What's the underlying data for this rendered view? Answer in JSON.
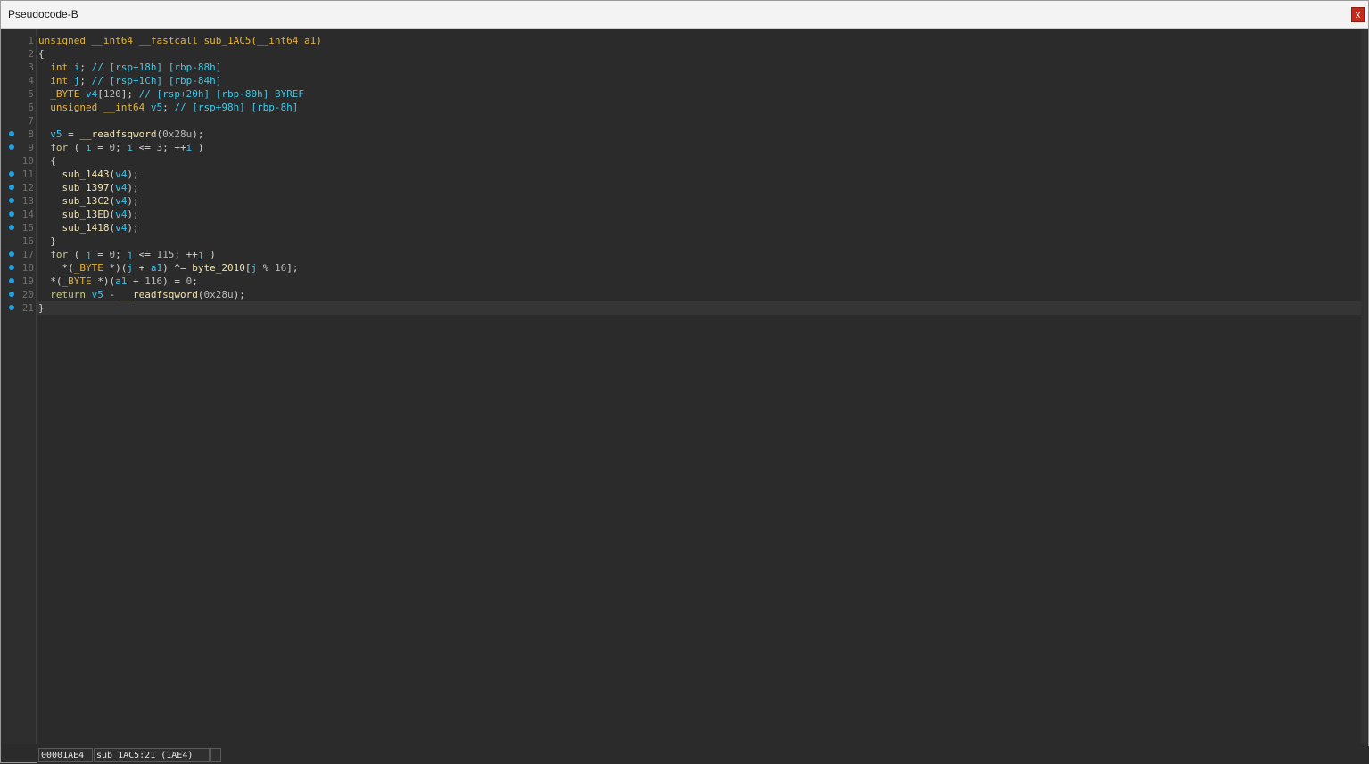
{
  "window": {
    "title": "Pseudocode-B",
    "close_label": "x"
  },
  "code": {
    "lines": [
      {
        "n": "1",
        "bp": false,
        "text": "unsigned __int64 __fastcall sub_1AC5(__int64 a1)"
      },
      {
        "n": "2",
        "bp": false,
        "text": "{"
      },
      {
        "n": "3",
        "bp": false,
        "text": "  int i; // [rsp+18h] [rbp-88h]"
      },
      {
        "n": "4",
        "bp": false,
        "text": "  int j; // [rsp+1Ch] [rbp-84h]"
      },
      {
        "n": "5",
        "bp": false,
        "text": "  _BYTE v4[120]; // [rsp+20h] [rbp-80h] BYREF"
      },
      {
        "n": "6",
        "bp": false,
        "text": "  unsigned __int64 v5; // [rsp+98h] [rbp-8h]"
      },
      {
        "n": "7",
        "bp": false,
        "text": ""
      },
      {
        "n": "8",
        "bp": true,
        "text": "  v5 = __readfsqword(0x28u);"
      },
      {
        "n": "9",
        "bp": true,
        "text": "  for ( i = 0; i <= 3; ++i )"
      },
      {
        "n": "10",
        "bp": false,
        "text": "  {"
      },
      {
        "n": "11",
        "bp": true,
        "text": "    sub_1443(v4);"
      },
      {
        "n": "12",
        "bp": true,
        "text": "    sub_1397(v4);"
      },
      {
        "n": "13",
        "bp": true,
        "text": "    sub_13C2(v4);"
      },
      {
        "n": "14",
        "bp": true,
        "text": "    sub_13ED(v4);"
      },
      {
        "n": "15",
        "bp": true,
        "text": "    sub_1418(v4);"
      },
      {
        "n": "16",
        "bp": false,
        "text": "  }"
      },
      {
        "n": "17",
        "bp": true,
        "text": "  for ( j = 0; j <= 115; ++j )"
      },
      {
        "n": "18",
        "bp": true,
        "text": "    *(_BYTE *)(j + a1) ^= byte_2010[j % 16];"
      },
      {
        "n": "19",
        "bp": true,
        "text": "  *(_BYTE *)(a1 + 116) = 0;"
      },
      {
        "n": "20",
        "bp": true,
        "text": "  return v5 - __readfsqword(0x28u);"
      },
      {
        "n": "21",
        "bp": true,
        "text": "}"
      }
    ]
  },
  "status": {
    "address": "00001AE4",
    "location": "sub_1AC5:21 (1AE4)",
    "extra": ""
  },
  "colors": {
    "background": "#2b2b2b",
    "breakpoint": "#1ea3e6",
    "keyword": "#c9c98a",
    "type": "#e5b33b",
    "function": "#f0e3b0",
    "variable": "#39c6f0",
    "comment": "#3fc8e8"
  }
}
